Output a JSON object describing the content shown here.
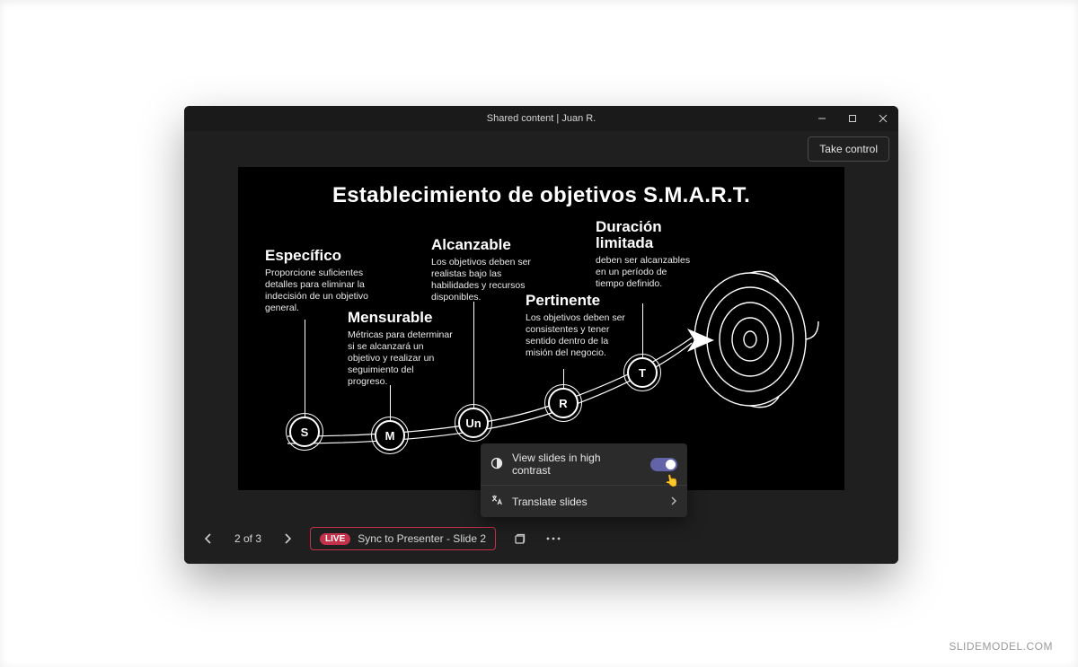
{
  "window": {
    "title": "Shared content | Juan R."
  },
  "toolbar": {
    "take_control": "Take control"
  },
  "slide": {
    "title": "Establecimiento de objetivos S.M.A.R.T.",
    "items": [
      {
        "letter": "S",
        "heading": "Específico",
        "body": "Proporcione suficientes detalles para eliminar la indecisión de un objetivo general."
      },
      {
        "letter": "M",
        "heading": "Mensurable",
        "body": "Métricas para determinar si se alcanzará un objetivo y realizar un seguimiento del progreso."
      },
      {
        "letter": "Un",
        "heading": "Alcanzable",
        "body": "Los objetivos deben ser realistas bajo las habilidades y recursos disponibles."
      },
      {
        "letter": "R",
        "heading": "Pertinente",
        "body": "Los objetivos deben ser consistentes y tener sentido dentro de la misión del negocio."
      },
      {
        "letter": "T",
        "heading": "Duración limitada",
        "body": "deben ser alcanzables en un período de tiempo definido."
      }
    ]
  },
  "bottombar": {
    "page": "2 of 3",
    "live": "LIVE",
    "sync": "Sync to Presenter - Slide 2"
  },
  "popup": {
    "high_contrast": "View slides in high contrast",
    "translate": "Translate slides"
  },
  "watermark": "SLIDEMODEL.COM"
}
